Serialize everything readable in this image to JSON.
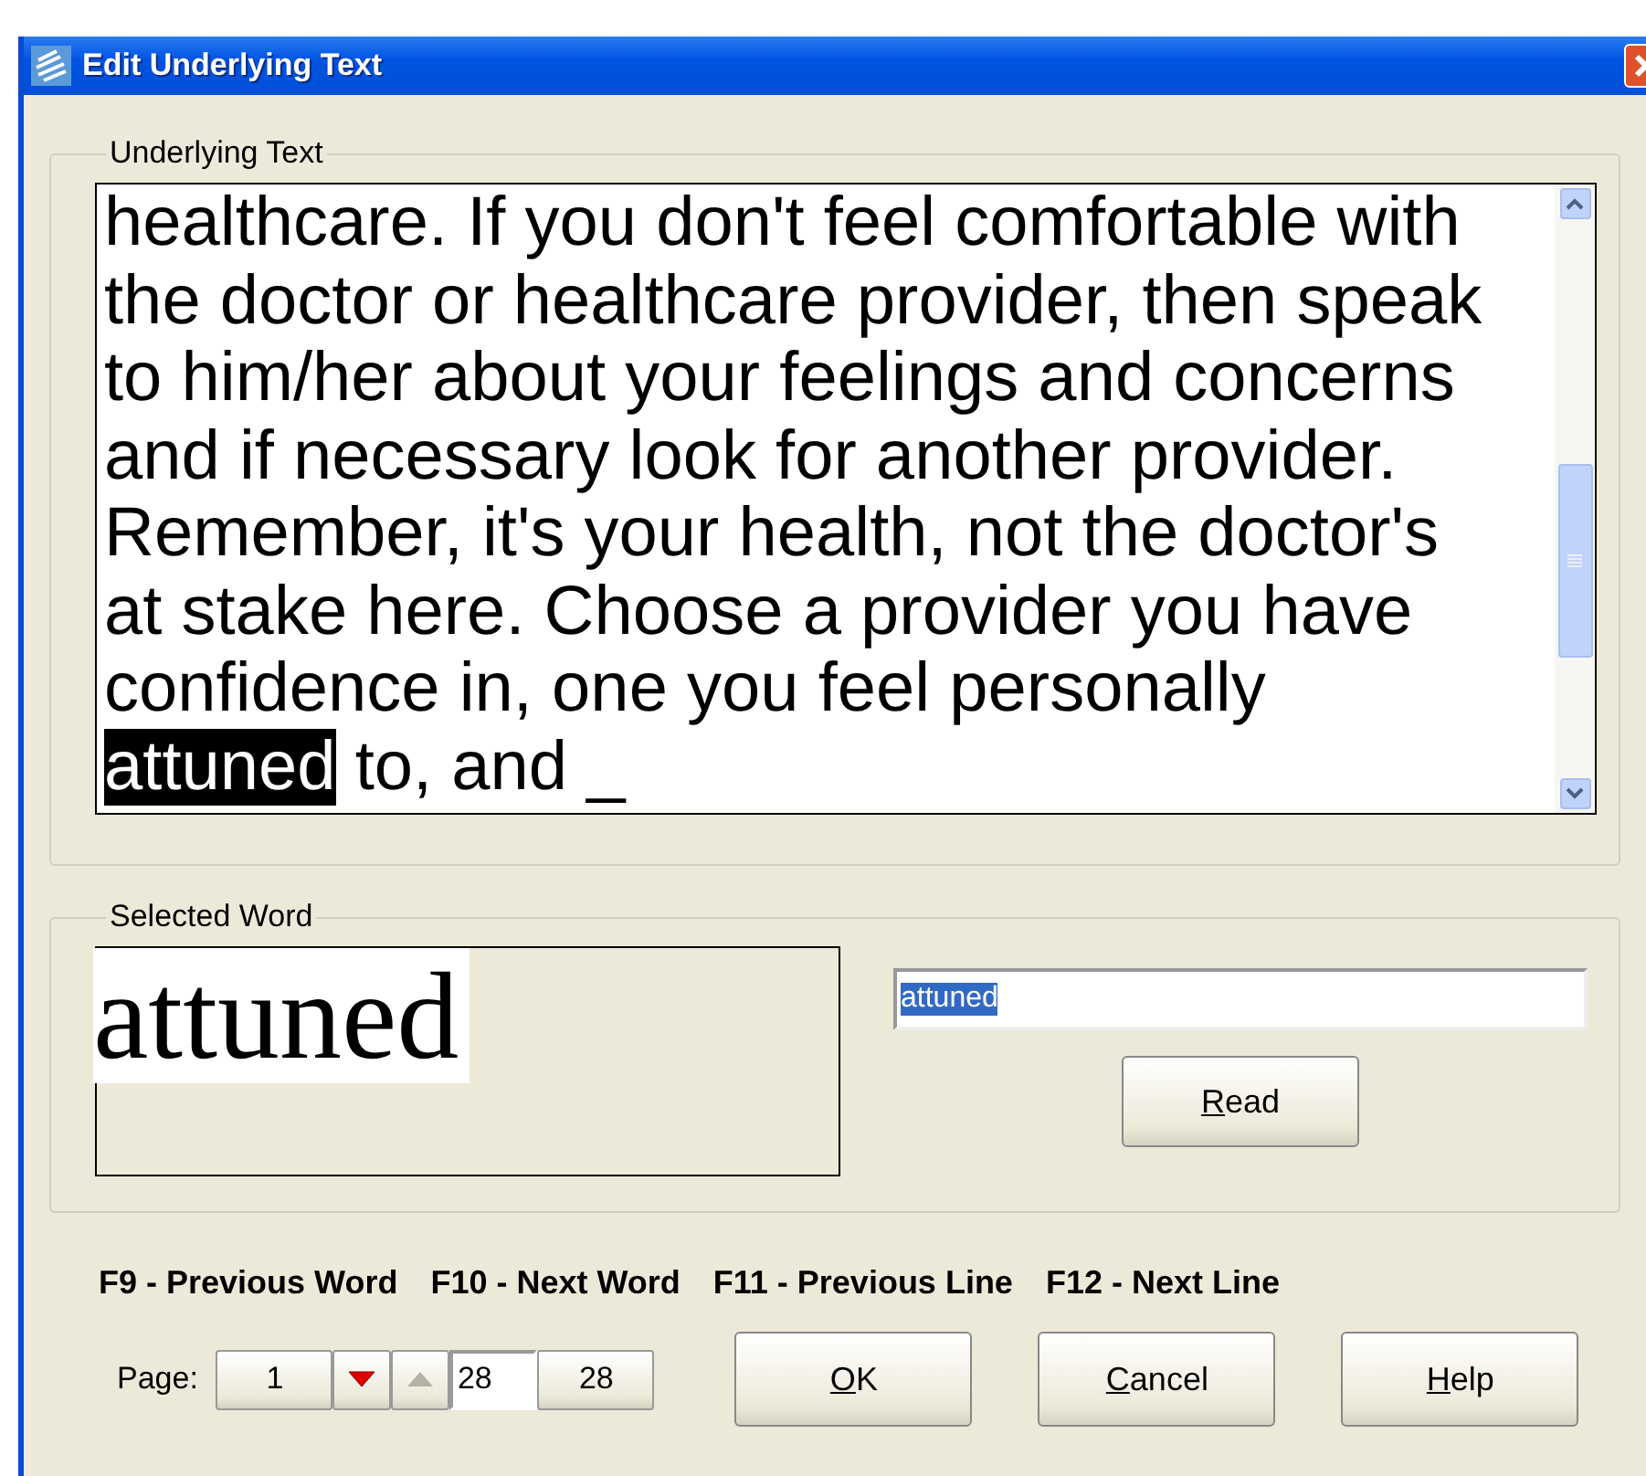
{
  "window": {
    "title": "Edit Underlying Text"
  },
  "underlying_text": {
    "label": "Underlying Text",
    "lines": [
      {
        "segments": [
          {
            "text": "healthcare. If you don't feel comfortable with",
            "selected": false
          }
        ]
      },
      {
        "segments": [
          {
            "text": "the doctor or healthcare provider, then speak",
            "selected": false
          }
        ]
      },
      {
        "segments": [
          {
            "text": "to him/her about your feelings and concerns",
            "selected": false
          }
        ]
      },
      {
        "segments": [
          {
            "text": "and if necessary look for another provider.",
            "selected": false
          }
        ]
      },
      {
        "segments": [
          {
            "text": "Remember, it's your health, not the doctor's",
            "selected": false
          }
        ]
      },
      {
        "segments": [
          {
            "text": "at stake here. Choose a provider you have",
            "selected": false
          }
        ]
      },
      {
        "segments": [
          {
            "text": "confidence in, one you feel personally",
            "selected": false
          }
        ]
      },
      {
        "segments": [
          {
            "text": "attuned",
            "selected": true
          },
          {
            "text": " to, and _",
            "selected": false
          }
        ]
      }
    ]
  },
  "selected_word": {
    "label": "Selected Word",
    "image_text": "attuned",
    "field_value": "attuned",
    "read_button": "Read"
  },
  "shortcuts": [
    "F9 - Previous Word",
    "F10 - Next Word",
    "F11 - Previous Line",
    "F12 - Next Line"
  ],
  "page_nav": {
    "label": "Page:",
    "first": "1",
    "arrows": [
      {
        "kind": "down",
        "disabled": false
      },
      {
        "kind": "up",
        "disabled": true
      }
    ],
    "current": "28",
    "last": "28"
  },
  "buttons": [
    "OK",
    "Cancel",
    "Help"
  ]
}
